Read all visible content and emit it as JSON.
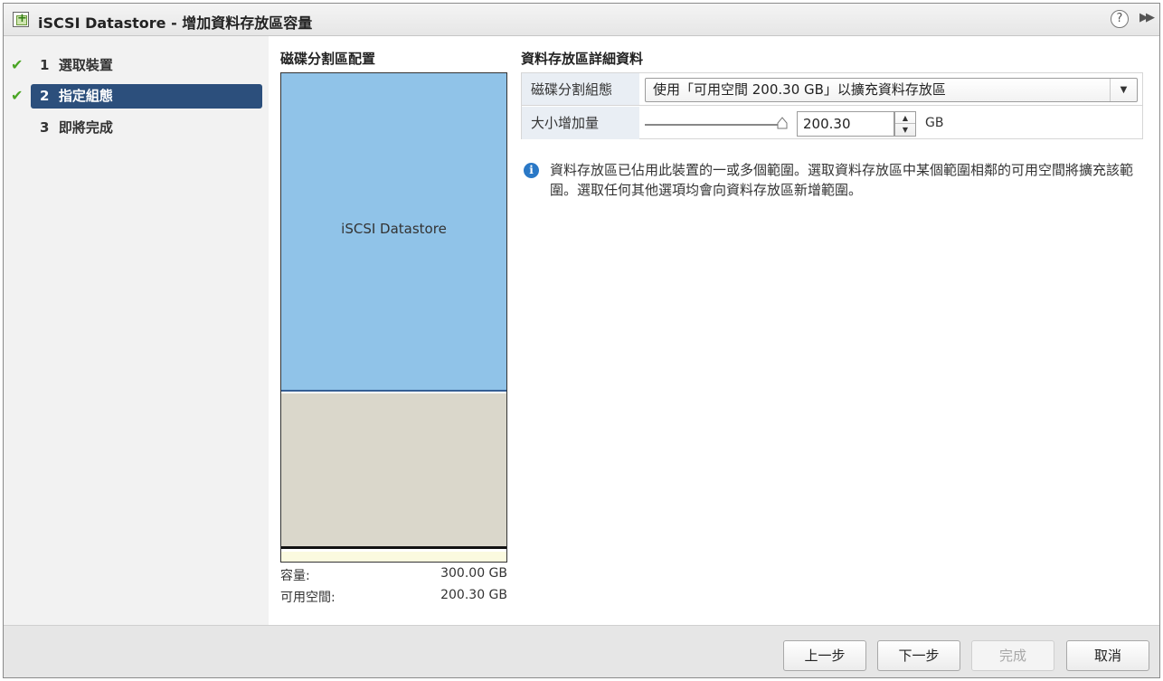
{
  "window": {
    "title": "iSCSI Datastore - 增加資料存放區容量",
    "help_glyph": "?",
    "expand_glyph": "▶▶"
  },
  "nav": {
    "items": [
      {
        "number": "1",
        "label": "選取裝置",
        "completed": true,
        "active": false
      },
      {
        "number": "2",
        "label": "指定組態",
        "completed": true,
        "active": true
      },
      {
        "number": "3",
        "label": "即將完成",
        "completed": false,
        "active": false
      }
    ]
  },
  "layout": {
    "title": "磁碟分割區配置",
    "used_label": "iSCSI Datastore",
    "capacity_label": "容量:",
    "capacity_value": "300.00 GB",
    "free_label": "可用空間:",
    "free_value": "200.30 GB",
    "colors": {
      "used": "#90c3e8",
      "free": "#dad7cb"
    }
  },
  "details": {
    "title": "資料存放區詳細資料",
    "partition_label": "磁碟分割組態",
    "partition_value": "使用「可用空間 200.30 GB」以擴充資料存放區",
    "increase_label": "大小增加量",
    "increase_value": "200.30",
    "increase_unit": "GB",
    "slider_fraction": 1.0
  },
  "info": {
    "icon": "info-icon",
    "text": "資料存放區已佔用此裝置的一或多個範圍。選取資料存放區中某個範圍相鄰的可用空間將擴充該範圍。選取任何其他選項均會向資料存放區新增範圍。"
  },
  "footer": {
    "back_label": "上一步",
    "next_label": "下一步",
    "finish_label": "完成",
    "cancel_label": "取消"
  }
}
